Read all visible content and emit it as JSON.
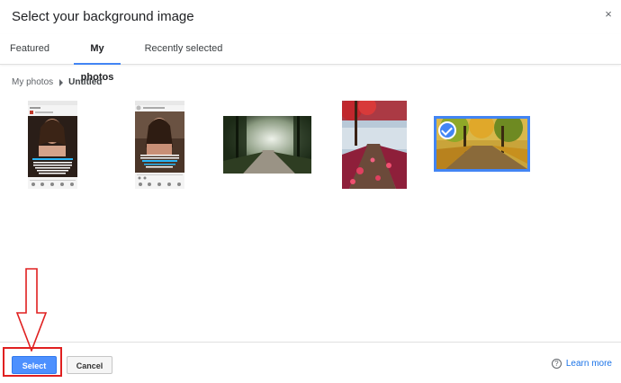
{
  "dialog": {
    "title": "Select your background image",
    "close_glyph": "×"
  },
  "tabs": [
    {
      "label": "Featured",
      "active": false
    },
    {
      "label": "My photos",
      "active": true
    },
    {
      "label": "Recently selected",
      "active": false
    }
  ],
  "breadcrumb": {
    "root": "My photos",
    "current": "Untitled"
  },
  "photos": [
    {
      "subject": "phone screenshot portrait woman",
      "selected": false
    },
    {
      "subject": "phone screenshot portrait woman smiling",
      "selected": false
    },
    {
      "subject": "misty forest road",
      "selected": false
    },
    {
      "subject": "lake pier with red leaves",
      "selected": false
    },
    {
      "subject": "autumn park path",
      "selected": true
    }
  ],
  "footer": {
    "select_label": "Select",
    "cancel_label": "Cancel",
    "learn_more_label": "Learn more",
    "help_glyph": "?"
  },
  "colors": {
    "accent": "#4285f4",
    "select_button": "#4d90fe",
    "annotation": "#e02020",
    "link": "#1a73e8"
  }
}
